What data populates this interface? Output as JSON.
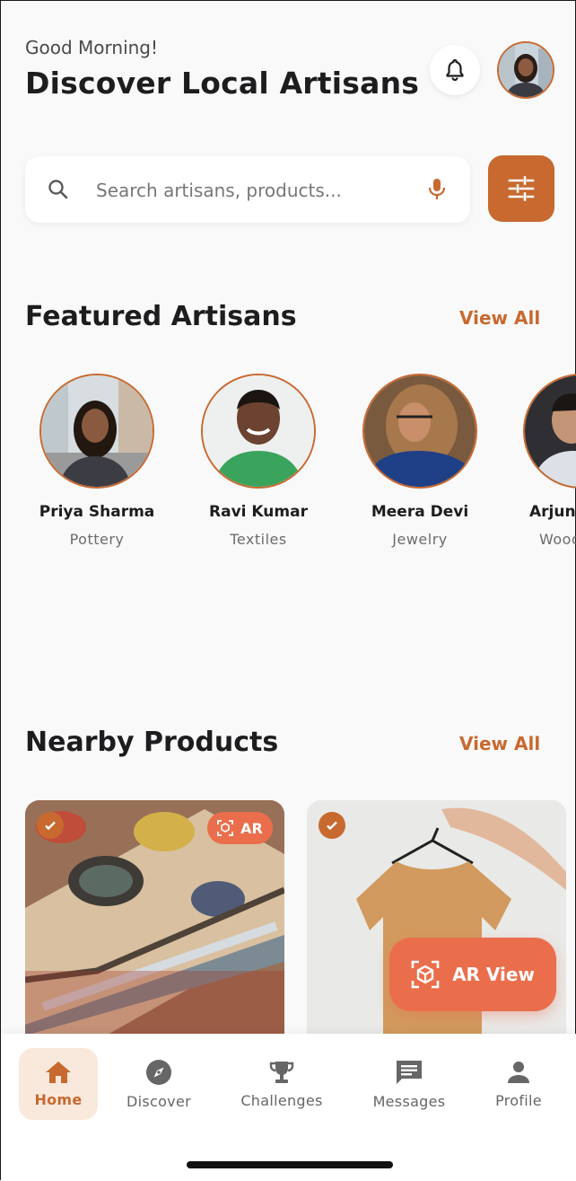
{
  "header": {
    "greeting": "Good Morning!",
    "title": "Discover Local Artisans"
  },
  "search": {
    "placeholder": "Search artisans, products...",
    "value": ""
  },
  "featured": {
    "title": "Featured Artisans",
    "view_all": "View All",
    "artisans": [
      {
        "name": "Priya Sharma",
        "craft": "Pottery"
      },
      {
        "name": "Ravi Kumar",
        "craft": "Textiles"
      },
      {
        "name": "Meera Devi",
        "craft": "Jewelry"
      },
      {
        "name": "Arjun",
        "craft": "Wood"
      }
    ]
  },
  "nearby": {
    "title": "Nearby Products",
    "view_all": "View All",
    "ar_badge": "AR",
    "ar_view": "AR View"
  },
  "nav": [
    {
      "label": "Home",
      "icon": "home-icon",
      "active": true
    },
    {
      "label": "Discover",
      "icon": "compass-icon",
      "active": false
    },
    {
      "label": "Challenges",
      "icon": "trophy-icon",
      "active": false
    },
    {
      "label": "Messages",
      "icon": "message-icon",
      "active": false
    },
    {
      "label": "Profile",
      "icon": "person-icon",
      "active": false
    }
  ],
  "colors": {
    "accent": "#c8692f",
    "ar": "#ea6e4c",
    "background": "#f9f9fa"
  }
}
